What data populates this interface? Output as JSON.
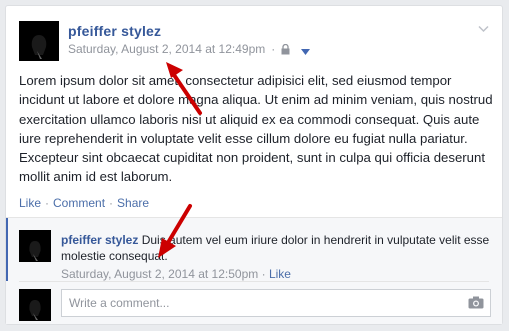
{
  "post": {
    "author": "pfeiffer stylez",
    "timestamp": "Saturday, August 2, 2014 at 12:49pm",
    "separator": "·",
    "privacy_icon": "lock-icon",
    "audience_menu_icon": "caret-down-icon",
    "options_icon": "chevron-down-icon",
    "text": "Lorem ipsum dolor sit amet, consectetur adipisici elit, sed eiusmod tempor incidunt ut labore et dolore magna aliqua. Ut enim ad minim veniam, quis nostrud exercitation ullamco laboris nisi ut aliquid ex ea commodi consequat. Quis aute iure reprehenderit in voluptate velit esse cillum dolore eu fugiat nulla pariatur. Excepteur sint obcaecat cupiditat non proident, sunt in culpa qui officia deserunt mollit anim id est laborum."
  },
  "actions": {
    "like": "Like",
    "comment": "Comment",
    "share": "Share",
    "separator": "·"
  },
  "comment": {
    "author": "pfeiffer stylez",
    "text": "Duis autem vel eum iriure dolor in hendrerit in vulputate velit esse molestie consequat.",
    "timestamp": "Saturday, August 2, 2014 at 12:50pm",
    "separator": "·",
    "like": "Like"
  },
  "composer": {
    "placeholder": "Write a comment...",
    "camera_icon": "camera-icon"
  },
  "colors": {
    "link": "#365899",
    "meta": "#90949c",
    "annotation_arrow": "#cc0000"
  }
}
